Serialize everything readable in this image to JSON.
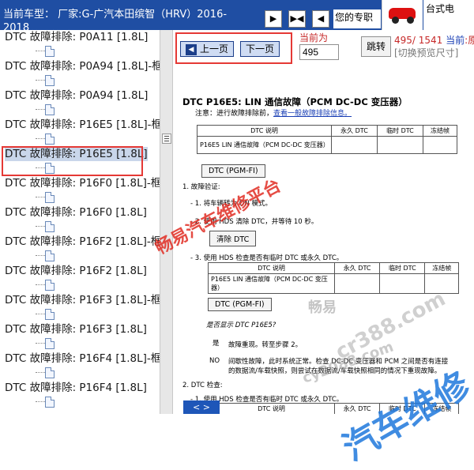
{
  "header": {
    "title": "当前车型： 厂家:G-广汽本田缤智（HRV）2016-2018",
    "tip": "您的专职",
    "side_text": "台式电",
    "tool_buttons": [
      "▶",
      "▶◀",
      "◀"
    ]
  },
  "tree": {
    "items": [
      {
        "label": "DTC 故障排除: P0A11 [1.8L]"
      },
      {
        "label": "DTC 故障排除: P0A94 [1.8L]-框架"
      },
      {
        "label": "DTC 故障排除: P0A94 [1.8L]"
      },
      {
        "label": "DTC 故障排除: P16E5 [1.8L]-框架"
      },
      {
        "label": "DTC 故障排除: P16E5 [1.8L]"
      },
      {
        "label": "DTC 故障排除: P16F0 [1.8L]-框架"
      },
      {
        "label": "DTC 故障排除: P16F0 [1.8L]"
      },
      {
        "label": "DTC 故障排除: P16F2 [1.8L]-框架"
      },
      {
        "label": "DTC 故障排除: P16F2 [1.8L]"
      },
      {
        "label": "DTC 故障排除: P16F3 [1.8L]-框架"
      },
      {
        "label": "DTC 故障排除: P16F3 [1.8L]"
      },
      {
        "label": "DTC 故障排除: P16F4 [1.8L]-框架"
      },
      {
        "label": "DTC 故障排除: P16F4 [1.8L]"
      }
    ],
    "selected_index": 4
  },
  "nav": {
    "prev_label": "上一页",
    "next_label": "下一页",
    "current_label": "当前为",
    "page_value": "495",
    "jump_label": "跳转",
    "page_counter": "495/ 1541",
    "current_prefix": "当前",
    "current_suffix": ":原",
    "switch_size": "[切换预览尺寸]"
  },
  "doc": {
    "title": "DTC P16E5: LIN 通信故障（PCM DC-DC 变压器）",
    "note_prefix": "注意：进行故障排除前，",
    "note_link": "查看一般故障排除信息。",
    "table_headers": [
      "DTC 说明",
      "永久 DTC",
      "临时 DTC",
      "冻结帧"
    ],
    "table_row": "P16E5 LIN 通信故障（PCM DC-DC 变压器）",
    "btn_pgmfi": "DTC (PGM-FI)",
    "step1": "1.  故障验证:",
    "step1_1": "- 1. 将车辆转为 ON 模式。",
    "step1_2": "- 2. 使用 HDS 清除 DTC，并等待 10 秒。",
    "btn_clear": "清除 DTC",
    "step1_3": "- 3. 使用 HDS 检查是否有临时 DTC 或永久 DTC。",
    "question": "是否显示 DTC P16E5?",
    "yes_label": "是",
    "yes_text": "故障重现。转至步骤 2。",
    "no_label": "NO",
    "no_text_1": "间歇性故障，此时系统正常。检查 DC-DC 变压器和 PCM 之间是否有连接",
    "no_text_2": "的数据流/车载快照，则尝试在数据流/车载快照相同的情况下重现故障。",
    "step2": "2.  DTC 检查:",
    "step2_1": "- 1. 使用 HDS 检查是否有临时 DTC 或永久 DTC。"
  },
  "watermarks": {
    "brand": "畅易汽车维修平台",
    "site1": "畅易",
    "site2": "cr388.com",
    "site3": "汽车维修",
    "site4": "cy2088.com"
  },
  "bottom_button": "< >"
}
